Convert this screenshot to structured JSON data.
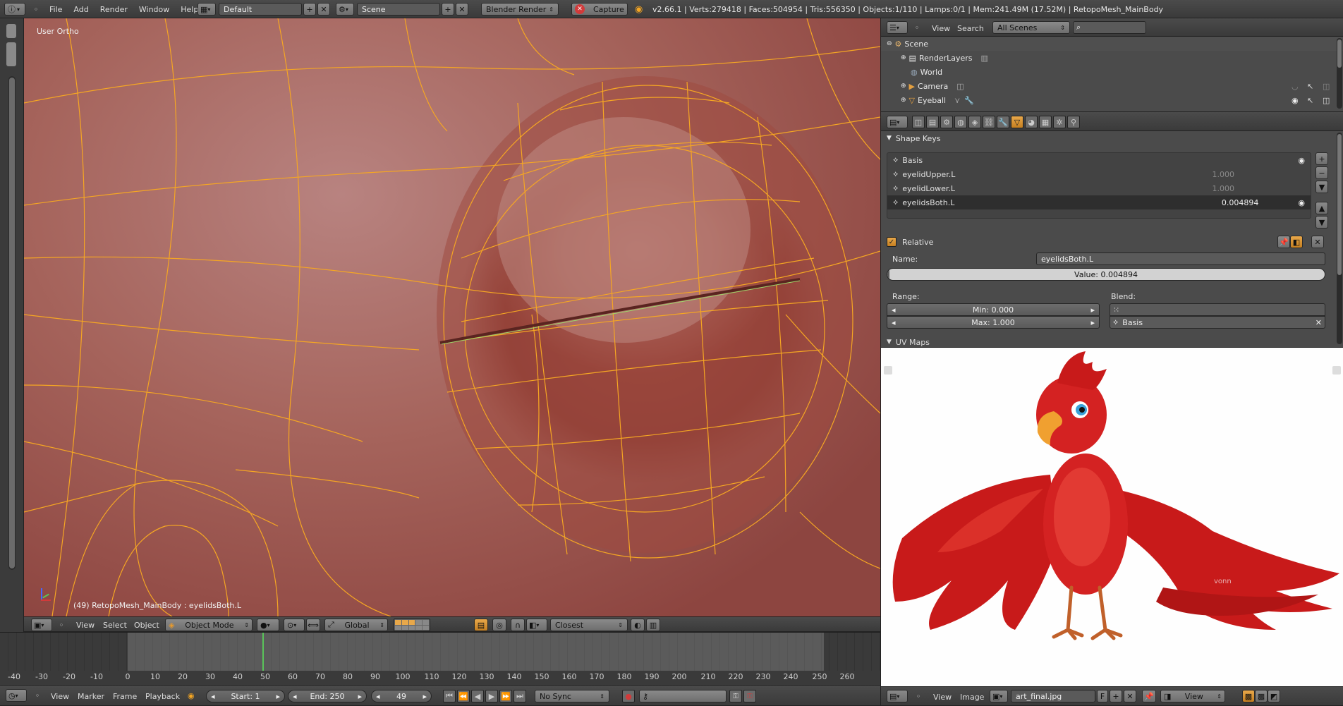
{
  "topbar": {
    "menus": [
      "File",
      "Add",
      "Render",
      "Window",
      "Help"
    ],
    "layout": "Default",
    "scene": "Scene",
    "engine": "Blender Render",
    "capture": "Capture",
    "stats": "v2.66.1 | Verts:279418 | Faces:504954 | Tris:556350 | Objects:1/110 | Lamps:0/1 | Mem:241.49M (17.52M) | RetopoMesh_MainBody"
  },
  "viewport": {
    "view_label": "User Ortho",
    "object_label": "(49) RetopoMesh_MainBody : eyelidsBoth.L",
    "menus": [
      "View",
      "Select",
      "Object"
    ],
    "mode": "Object Mode",
    "orientation": "Global",
    "snap": "Closest"
  },
  "outliner": {
    "menus": [
      "View",
      "Search"
    ],
    "filter": "All Scenes",
    "items": [
      {
        "label": "Scene"
      },
      {
        "label": "RenderLayers"
      },
      {
        "label": "World"
      },
      {
        "label": "Camera"
      },
      {
        "label": "Eyeball"
      }
    ]
  },
  "properties": {
    "panel_title": "Shape Keys",
    "shape_keys": [
      {
        "name": "Basis",
        "value": ""
      },
      {
        "name": "eyelidUpper.L",
        "value": "1.000"
      },
      {
        "name": "eyelidLower.L",
        "value": "1.000"
      },
      {
        "name": "eyelidsBoth.L",
        "value": "0.004894"
      }
    ],
    "relative_label": "Relative",
    "name_label": "Name:",
    "name_value": "eyelidsBoth.L",
    "value_field": "Value: 0.004894",
    "value_fraction": 0.004894,
    "range_label": "Range:",
    "blend_label": "Blend:",
    "min_field": "Min: 0.000",
    "max_field": "Max: 1.000",
    "blend_value": "Basis",
    "next_panel": "UV Maps"
  },
  "image_editor": {
    "menus": [
      "View",
      "Image"
    ],
    "image_name": "art_final.jpg",
    "image_flag": "F",
    "display": "View",
    "watermark": "vonn"
  },
  "timeline": {
    "ticks": [
      -40,
      -30,
      -20,
      -10,
      0,
      10,
      20,
      30,
      40,
      50,
      60,
      70,
      80,
      90,
      100,
      110,
      120,
      130,
      140,
      150,
      160,
      170,
      180,
      190,
      200,
      210,
      220,
      230,
      240,
      250,
      260
    ],
    "menus": [
      "View",
      "Marker",
      "Frame",
      "Playback"
    ],
    "start": "Start: 1",
    "end": "End: 250",
    "current": "49",
    "sync": "No Sync"
  },
  "colors": {
    "accent": "#f5a623",
    "mesh": "#b5574d",
    "selected_row": "#2a2a2a"
  }
}
